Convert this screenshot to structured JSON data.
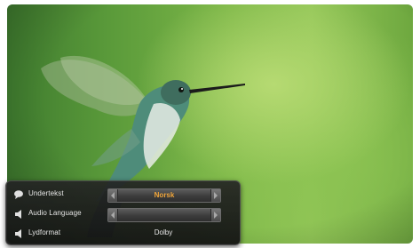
{
  "menu": {
    "rows": [
      {
        "label": "Undertekst",
        "value": "Norsk",
        "icon": "speech-bubble-icon"
      },
      {
        "label": "Audio Language",
        "value": "",
        "icon": "speaker-icon"
      },
      {
        "label": "Lydformat",
        "value": "Dolby",
        "icon": "speaker-icon"
      }
    ]
  },
  "colors": {
    "selected_value": "#f0a53a",
    "menu_background": "#1e1e1e",
    "label_text": "#e6e6e6"
  }
}
